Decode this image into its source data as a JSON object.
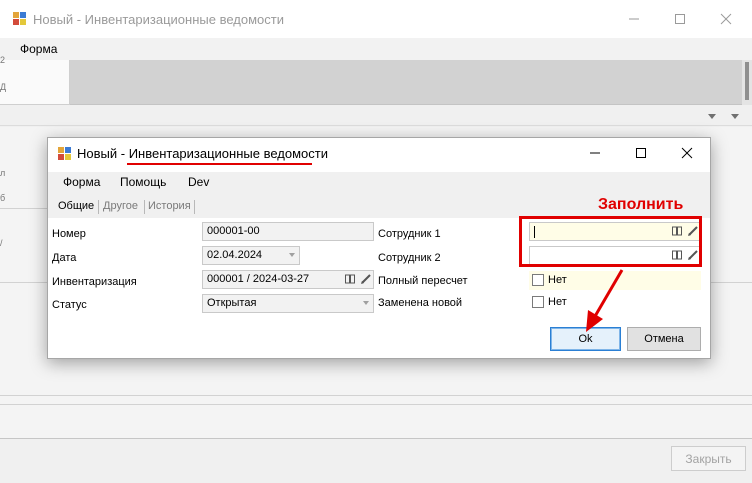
{
  "outer": {
    "title": "Новый - Инвентаризационные ведомости",
    "menu_form": "Форма",
    "edge_chars": [
      "2",
      "Д",
      "л",
      "б",
      "/"
    ],
    "close_button": "Закрыть"
  },
  "dialog": {
    "title_prefix": "Новый - ",
    "title_main": "Инвентаризационные ведомости",
    "menu": [
      "Форма",
      "Помощь",
      "Dev"
    ],
    "tabs": [
      "Общие",
      "Другое",
      "История"
    ],
    "fields": {
      "number_label": "Номер",
      "number_value": "000001-00",
      "date_label": "Дата",
      "date_value": "02.04.2024",
      "inventory_label": "Инвентаризация",
      "inventory_value": "000001 / 2024-03-27",
      "status_label": "Статус",
      "status_value": "Открытая",
      "employee1_label": "Сотрудник 1",
      "employee1_value": "",
      "employee2_label": "Сотрудник 2",
      "employee2_value": "",
      "recount_label": "Полный пересчет",
      "recount_checkbox": "Нет",
      "replaced_label": "Заменена новой",
      "replaced_checkbox": "Нет"
    },
    "ok_button": "Ok",
    "cancel_button": "Отмена"
  },
  "annotation": {
    "text": "Заполнить",
    "color": "#e00000"
  },
  "colors": {
    "highlight_field": "#fffde7",
    "default_button_border": "#2a7fd4"
  }
}
